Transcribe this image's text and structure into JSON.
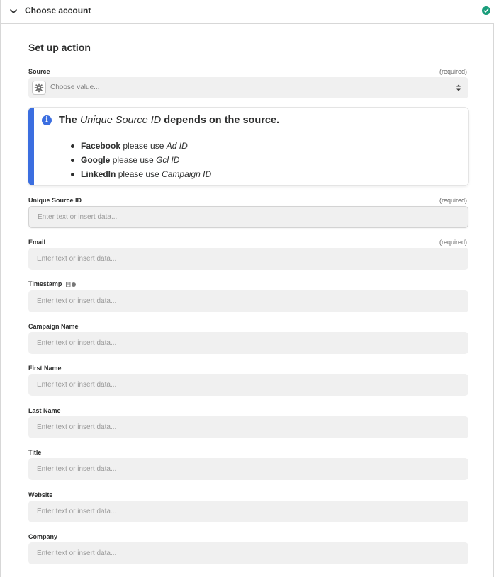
{
  "accordion": {
    "title": "Choose account",
    "status_color": "#1a9d7b"
  },
  "section": {
    "title": "Set up action"
  },
  "source": {
    "label": "Source",
    "required": "(required)",
    "placeholder": "Choose value..."
  },
  "info": {
    "title_prefix": "The",
    "title_italic": "Unique Source ID",
    "title_suffix": "depends on the source.",
    "accent_color": "#3b6ee0",
    "items": [
      {
        "bold": "Facebook",
        "text": "please use",
        "italic": "Ad ID"
      },
      {
        "bold": "Google",
        "text": "please use",
        "italic": "Gcl ID"
      },
      {
        "bold": "LinkedIn",
        "text": "please use",
        "italic": "Campaign ID"
      }
    ]
  },
  "fields": [
    {
      "label": "Unique Source ID",
      "required": "(required)",
      "placeholder": "Enter text or insert data..."
    },
    {
      "label": "Email",
      "required": "(required)",
      "placeholder": "Enter text or insert data..."
    },
    {
      "label": "Timestamp",
      "required": "",
      "placeholder": "Enter text or insert data..."
    },
    {
      "label": "Campaign Name",
      "required": "",
      "placeholder": "Enter text or insert data..."
    },
    {
      "label": "First Name",
      "required": "",
      "placeholder": "Enter text or insert data..."
    },
    {
      "label": "Last Name",
      "required": "",
      "placeholder": "Enter text or insert data..."
    },
    {
      "label": "Title",
      "required": "",
      "placeholder": "Enter text or insert data..."
    },
    {
      "label": "Website",
      "required": "",
      "placeholder": "Enter text or insert data..."
    },
    {
      "label": "Company",
      "required": "",
      "placeholder": "Enter text or insert data..."
    }
  ]
}
